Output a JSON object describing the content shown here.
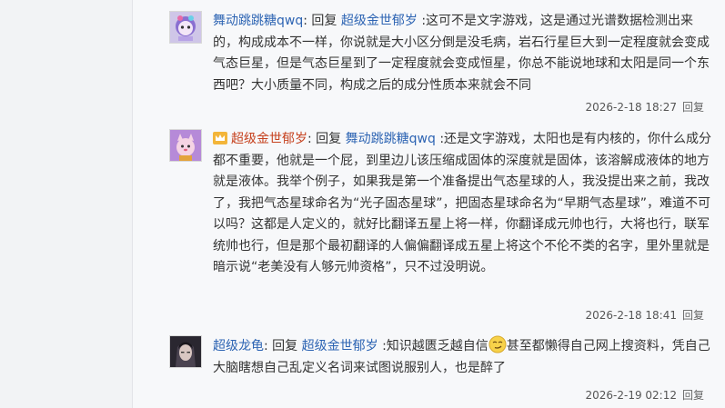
{
  "replies": [
    {
      "avatar": "avatar-purple-cartoon",
      "username": "舞动跳跳糖qwq",
      "colon": ":",
      "reply_word": "回复",
      "target_user": "超级金世郁岁",
      "text": ":这可不是文字游戏，这是通过光谱数据检测出来的，构成成本不一样，你说就是大小区分倒是没毛病，岩石行星巨大到一定程度就会变成气态巨星，但是气态巨星到了一定程度就会变成恒星，你总不能说地球和太阳是同一个东西吧？大小质量不同，构成之后的成分性质本来就会不同",
      "timestamp": "2026-2-18 18:27",
      "action": "回复"
    },
    {
      "avatar": "avatar-pink-cat",
      "badge": "crown-icon",
      "username": "超级金世郁岁",
      "colon": ":",
      "reply_word": "回复",
      "target_user": "舞动跳跳糖qwq",
      "text": ":还是文字游戏，太阳也是有内核的，你什么成分都不重要，他就是一个屁，到里边儿该压缩成固体的深度就是固体，该溶解成液体的地方就是液体。我举个例子，如果我是第一个准备提出气态星球的人，我没提出来之前，我改了，我把气态星球命名为“光子固态星球”，把固态星球命名为“早期气态星球”，难道不可以吗？这都是人定义的，就好比翻译五星上将一样，你翻译成元帅也行，大将也行，联军统帅也行，但是那个最初翻译的人偏偏翻译成五星上将这个不伦不类的名字，里外里就是暗示说“老美没有人够元帅资格”，只不过没明说。",
      "timestamp": "2026-2-18 18:41",
      "action": "回复"
    },
    {
      "avatar": "avatar-dark-character",
      "username": "超级龙龟",
      "colon": ":",
      "reply_word": "回复",
      "target_user": "超级金世郁岁",
      "text_before_emoji": ":知识越匮乏越自信",
      "emoji": "smirk-emoji-icon",
      "text_after_emoji": "甚至都懒得自己网上搜资料，凭自己大脑瞎想自己乱定义名词来试图说服别人，也是醉了",
      "timestamp": "2026-2-19 02:12",
      "action": "回复"
    }
  ]
}
